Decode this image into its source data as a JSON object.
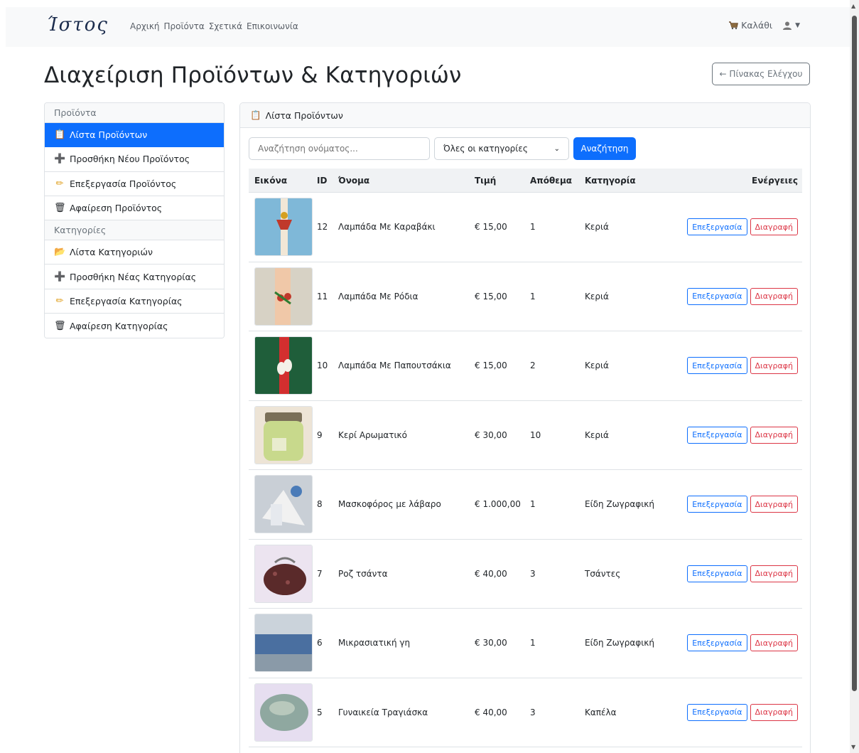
{
  "nav": {
    "brand": "Ίστος",
    "links": [
      "Αρχική",
      "Προϊόντα",
      "Σχετικά",
      "Επικοινωνία"
    ],
    "cart_label": "Καλάθι"
  },
  "page": {
    "title": "Διαχείριση Προϊόντων & Κατηγοριών",
    "dashboard_button": "← Πίνακας Ελέγχου"
  },
  "sidebar": {
    "products_header": "Προϊόντα",
    "categories_header": "Κατηγορίες",
    "items": [
      {
        "label": "Λίστα Προϊόντων",
        "icon": "clipboard-icon",
        "active": true
      },
      {
        "label": "Προσθήκη Νέου Προϊόντος",
        "icon": "plus-icon",
        "active": false
      },
      {
        "label": "Επεξεργασία Προϊόντος",
        "icon": "pencil-icon",
        "active": false
      },
      {
        "label": "Αφαίρεση Προϊόντος",
        "icon": "trash-icon",
        "active": false
      },
      {
        "label": "Λίστα Κατηγοριών",
        "icon": "folder-icon",
        "active": false
      },
      {
        "label": "Προσθήκη Νέας Κατηγορίας",
        "icon": "plus-icon",
        "active": false
      },
      {
        "label": "Επεξεργασία Κατηγορίας",
        "icon": "pencil-icon",
        "active": false
      },
      {
        "label": "Αφαίρεση Κατηγορίας",
        "icon": "trash-icon",
        "active": false
      }
    ]
  },
  "main": {
    "card_title": "Λίστα Προϊόντων",
    "search_placeholder": "Αναζήτηση ονόματος...",
    "category_select": "Όλες οι κατηγορίες",
    "search_button": "Αναζήτηση",
    "columns": [
      "Εικόνα",
      "ID",
      "Όνομα",
      "Τιμή",
      "Απόθεμα",
      "Κατηγορία",
      "Ενέργειες"
    ],
    "edit_label": "Επεξεργασία",
    "delete_label": "Διαγραφή",
    "rows": [
      {
        "id": "12",
        "name": "Λαμπάδα Με Καραβάκι",
        "price": "€ 15,00",
        "stock": "1",
        "category": "Κεριά"
      },
      {
        "id": "11",
        "name": "Λαμπάδα Με Ρόδια",
        "price": "€ 15,00",
        "stock": "1",
        "category": "Κεριά"
      },
      {
        "id": "10",
        "name": "Λαμπάδα Με Παπουτσάκια",
        "price": "€ 15,00",
        "stock": "2",
        "category": "Κεριά"
      },
      {
        "id": "9",
        "name": "Κερί Αρωματικό",
        "price": "€ 30,00",
        "stock": "10",
        "category": "Κεριά"
      },
      {
        "id": "8",
        "name": "Μασκοφόρος με λάβαρο",
        "price": "€ 1.000,00",
        "stock": "1",
        "category": "Είδη Ζωγραφική"
      },
      {
        "id": "7",
        "name": "Ροζ τσάντα",
        "price": "€ 40,00",
        "stock": "3",
        "category": "Τσάντες"
      },
      {
        "id": "6",
        "name": "Μικρασιατική γη",
        "price": "€ 30,00",
        "stock": "1",
        "category": "Είδη Ζωγραφική"
      },
      {
        "id": "5",
        "name": "Γυναικεία Τραγιάσκα",
        "price": "€ 40,00",
        "stock": "3",
        "category": "Καπέλα"
      }
    ]
  }
}
